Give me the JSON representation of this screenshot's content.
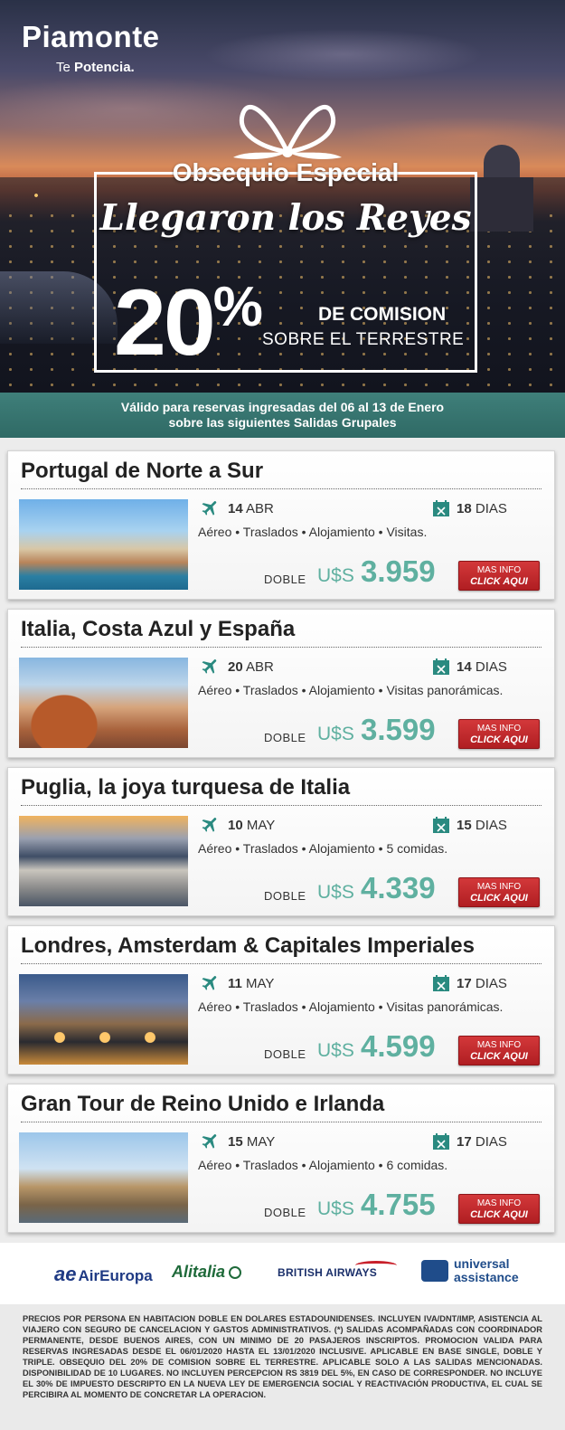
{
  "brand": {
    "name": "Piamonte",
    "tag_prefix": "Te ",
    "tag_bold": "Potencia."
  },
  "promo": {
    "gift": "Obsequio Especial",
    "headline": "Llegaron los Reyes",
    "percent_number": "20",
    "percent_sign": "%",
    "commission": "DE COMISION",
    "scope": "SOBRE EL TERRESTRE"
  },
  "validity": {
    "line1": "Válido para reservas ingresadas del 06 al 13 de Enero",
    "line2": "sobre las siguientes Salidas Grupales"
  },
  "tours": [
    {
      "title": "Portugal de Norte a Sur",
      "date_day": "14",
      "date_month": "ABR",
      "days_num": "18",
      "days_label": "DIAS",
      "services": "Aéreo • Traslados • Alojamiento • Visitas.",
      "room": "DOBLE",
      "currency": "U$S",
      "price": "3.959",
      "btn_line1": "MAS INFO",
      "btn_line2": "CLICK AQUI"
    },
    {
      "title": "Italia, Costa Azul y España",
      "date_day": "20",
      "date_month": "ABR",
      "days_num": "14",
      "days_label": "DIAS",
      "services": "Aéreo • Traslados • Alojamiento • Visitas panorámicas.",
      "room": "DOBLE",
      "currency": "U$S",
      "price": "3.599",
      "btn_line1": "MAS INFO",
      "btn_line2": "CLICK AQUI"
    },
    {
      "title": "Puglia, la joya turquesa de Italia",
      "date_day": "10",
      "date_month": "MAY",
      "days_num": "15",
      "days_label": "DIAS",
      "services": "Aéreo • Traslados • Alojamiento • 5 comidas.",
      "room": "DOBLE",
      "currency": "U$S",
      "price": "4.339",
      "btn_line1": "MAS INFO",
      "btn_line2": "CLICK AQUI"
    },
    {
      "title": "Londres, Amsterdam & Capitales Imperiales",
      "date_day": "11",
      "date_month": "MAY",
      "days_num": "17",
      "days_label": "DIAS",
      "services": "Aéreo • Traslados • Alojamiento • Visitas panorámicas.",
      "room": "DOBLE",
      "currency": "U$S",
      "price": "4.599",
      "btn_line1": "MAS INFO",
      "btn_line2": "CLICK AQUI"
    },
    {
      "title": "Gran Tour de Reino Unido e Irlanda",
      "date_day": "15",
      "date_month": "MAY",
      "days_num": "17",
      "days_label": "DIAS",
      "services": "Aéreo • Traslados • Alojamiento • 6 comidas.",
      "room": "DOBLE",
      "currency": "U$S",
      "price": "4.755",
      "btn_line1": "MAS INFO",
      "btn_line2": "CLICK AQUI"
    }
  ],
  "partners": {
    "aireuropa": {
      "mark": "ae",
      "name": "AirEuropa"
    },
    "alitalia": "Alitalia",
    "ba": "BRITISH AIRWAYS",
    "ua_line1": "universal",
    "ua_line2": "assistance"
  },
  "colors": {
    "accent_teal": "#5fb0a0",
    "button_red": "#c0282c",
    "band_teal": "#3f7f7a"
  },
  "icons": {
    "flight": "plane-icon",
    "duration": "calendar-icon"
  },
  "footer": "PRECIOS POR PERSONA EN HABITACION DOBLE EN DOLARES ESTADOUNIDENSES. INCLUYEN IVA/DNT/IMP, ASISTENCIA AL VIAJERO CON SEGURO DE CANCELACION Y GASTOS ADMINISTRATIVOS. (*) SALIDAS ACOMPAÑADAS CON COORDINADOR PERMANENTE, DESDE BUENOS AIRES, CON UN MINIMO DE 20 PASAJEROS INSCRIPTOS. PROMOCION VALIDA PARA RESERVAS INGRESADAS DESDE EL 06/01/2020 HASTA EL 13/01/2020 INCLUSIVE. APLICABLE EN BASE SINGLE, DOBLE Y TRIPLE. OBSEQUIO DEL 20% DE COMISION SOBRE EL TERRESTRE. APLICABLE SOLO A LAS SALIDAS MENCIONADAS. DISPONIBILIDAD DE 10 LUGARES. NO INCLUYEN PERCEPCION RS 3819 DEL 5%, EN CASO DE CORRESPONDER. NO INCLUYE EL 30% DE IMPUESTO DESCRIPTO EN LA NUEVA LEY DE EMERGENCIA SOCIAL Y REACTIVACIÓN PRODUCTIVA, EL CUAL SE PERCIBIRA AL MOMENTO DE CONCRETAR LA OPERACION."
}
